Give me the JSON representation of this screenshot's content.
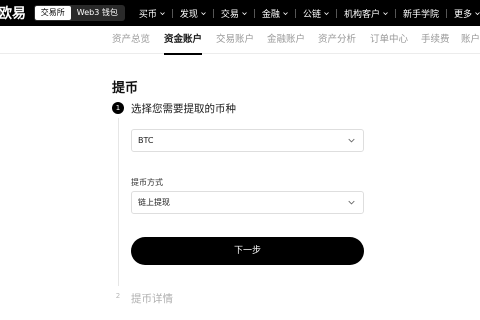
{
  "header": {
    "logo_text": "欧易",
    "switch": [
      {
        "label": "交易所",
        "active": true
      },
      {
        "label": "Web3 钱包",
        "active": false
      }
    ],
    "nav": [
      {
        "label": "买币",
        "dropdown": true
      },
      {
        "label": "发现",
        "dropdown": true
      },
      {
        "label": "交易",
        "dropdown": true
      },
      {
        "label": "金融",
        "dropdown": true
      },
      {
        "label": "公链",
        "dropdown": true
      },
      {
        "label": "机构客户",
        "dropdown": true
      },
      {
        "label": "新手学院",
        "dropdown": false
      },
      {
        "label": "更多",
        "dropdown": true
      }
    ]
  },
  "subnav": {
    "items": [
      "资产总览",
      "资金账户",
      "交易账户",
      "金融账户",
      "资产分析",
      "订单中心",
      "手续费",
      "账户"
    ],
    "active": "资金账户"
  },
  "main": {
    "title": "提币",
    "step1": {
      "number": "1",
      "title": "选择您需要提取的币种"
    },
    "coin_select": {
      "value": "BTC"
    },
    "method_label": "提币方式",
    "method_select": {
      "value": "链上提现"
    },
    "next_button": "下一步",
    "step2": {
      "number": "2",
      "title": "提币详情"
    }
  },
  "colors": {
    "primary": "#000000",
    "background": "#ffffff",
    "muted": "#9a9a9a"
  }
}
